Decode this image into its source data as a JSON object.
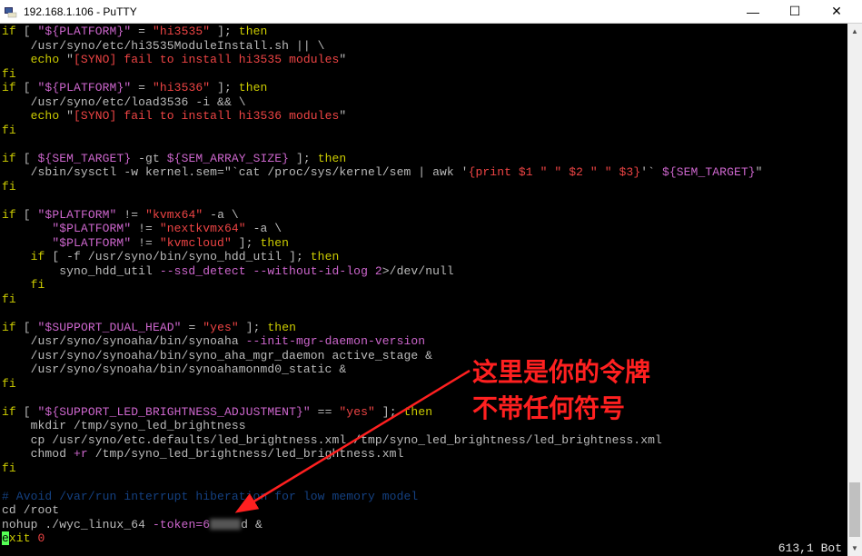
{
  "window": {
    "title": "192.168.1.106 - PuTTY",
    "minimize": "—",
    "maximize": "☐",
    "close": "✕"
  },
  "callout": {
    "line1": "这里是你的令牌",
    "line2": "不带任何符号"
  },
  "status": {
    "position": "613,1",
    "scroll": "Bot"
  },
  "code": {
    "l1_a": "if",
    "l1_b": " [ ",
    "l1_c": "\"${PLATFORM}\"",
    "l1_d": " = ",
    "l1_e": "\"hi3535\"",
    "l1_f": " ]; ",
    "l1_g": "then",
    "l2_a": "    /usr/syno/etc/hi3535ModuleInstall.sh || \\",
    "l3_a": "    ",
    "l3_b": "echo",
    "l3_c": " \"",
    "l3_d": "[SYNO] fail to install hi3535 modules",
    "l3_e": "\"",
    "l4_a": "fi",
    "l5_a": "if",
    "l5_b": " [ ",
    "l5_c": "\"${PLATFORM}\"",
    "l5_d": " = ",
    "l5_e": "\"hi3536\"",
    "l5_f": " ]; ",
    "l5_g": "then",
    "l6_a": "    /usr/syno/etc/load3536 -i && \\",
    "l7_a": "    ",
    "l7_b": "echo",
    "l7_c": " \"",
    "l7_d": "[SYNO] fail to install hi3536 modules",
    "l7_e": "\"",
    "l8_a": "fi",
    "l10_a": "if",
    "l10_b": " [ ",
    "l10_c": "${SEM_TARGET}",
    "l10_d": " -gt ",
    "l10_e": "${SEM_ARRAY_SIZE}",
    "l10_f": " ]; ",
    "l10_g": "then",
    "l11_a": "    /sbin/sysctl -w kernel.sem=\"`cat /proc/sys/kernel/sem | awk '",
    "l11_b": "{print $1 \" \" $2 \" \" $3}",
    "l11_c": "'` ",
    "l11_d": "${SEM_TARGET}",
    "l11_e": "\"",
    "l12_a": "fi",
    "l14_a": "if",
    "l14_b": " [ ",
    "l14_c": "\"$PLATFORM\"",
    "l14_d": " != ",
    "l14_e": "\"kvmx64\"",
    "l14_f": " -a \\",
    "l15_a": "       ",
    "l15_b": "\"$PLATFORM\"",
    "l15_c": " != ",
    "l15_d": "\"nextkvmx64\"",
    "l15_e": " -a \\",
    "l16_a": "       ",
    "l16_b": "\"$PLATFORM\"",
    "l16_c": " != ",
    "l16_d": "\"kvmcloud\"",
    "l16_e": " ]; ",
    "l16_f": "then",
    "l17_a": "    ",
    "l17_b": "if",
    "l17_c": " [ -f /usr/syno/bin/syno_hdd_util ]; ",
    "l17_d": "then",
    "l18_a": "        syno_hdd_util ",
    "l18_b": "--ssd_detect --without-id-log 2",
    "l18_c": ">/dev/null",
    "l19_a": "    ",
    "l19_b": "fi",
    "l20_a": "fi",
    "l22_a": "if",
    "l22_b": " [ ",
    "l22_c": "\"$SUPPORT_DUAL_HEAD\"",
    "l22_d": " = ",
    "l22_e": "\"yes\"",
    "l22_f": " ]; ",
    "l22_g": "then",
    "l23_a": "    /usr/syno/synoaha/bin/synoaha ",
    "l23_b": "--init-mgr-daemon-version",
    "l24_a": "    /usr/syno/synoaha/bin/syno_aha_mgr_daemon active_stage &",
    "l25_a": "    /usr/syno/synoaha/bin/synoahamonmd0_static &",
    "l26_a": "fi",
    "l28_a": "if",
    "l28_b": " [ ",
    "l28_c": "\"${SUPPORT_LED_BRIGHTNESS_ADJUSTMENT}\"",
    "l28_d": " == ",
    "l28_e": "\"yes\"",
    "l28_f": " ]; ",
    "l28_g": "then",
    "l29_a": "    mkdir /tmp/syno_led_brightness",
    "l30_a": "    cp /usr/syno/etc.defaults/led_brightness.xml /tmp/syno_led_brightness/led_brightness.xml",
    "l31_a": "    chmod ",
    "l31_b": "+r",
    "l31_c": " /tmp/syno_led_brightness/led_brightness.xml",
    "l32_a": "fi",
    "l34_a": "# Avoid /var/run interrupt hiberation for low memory model",
    "l35_a": "cd /root",
    "l36_a": "nohup ./wyc_linux_64 ",
    "l36_b": "-token=6",
    "l36_c": "d &",
    "l37_a": "e",
    "l37_b": "xit ",
    "l37_c": "0"
  }
}
